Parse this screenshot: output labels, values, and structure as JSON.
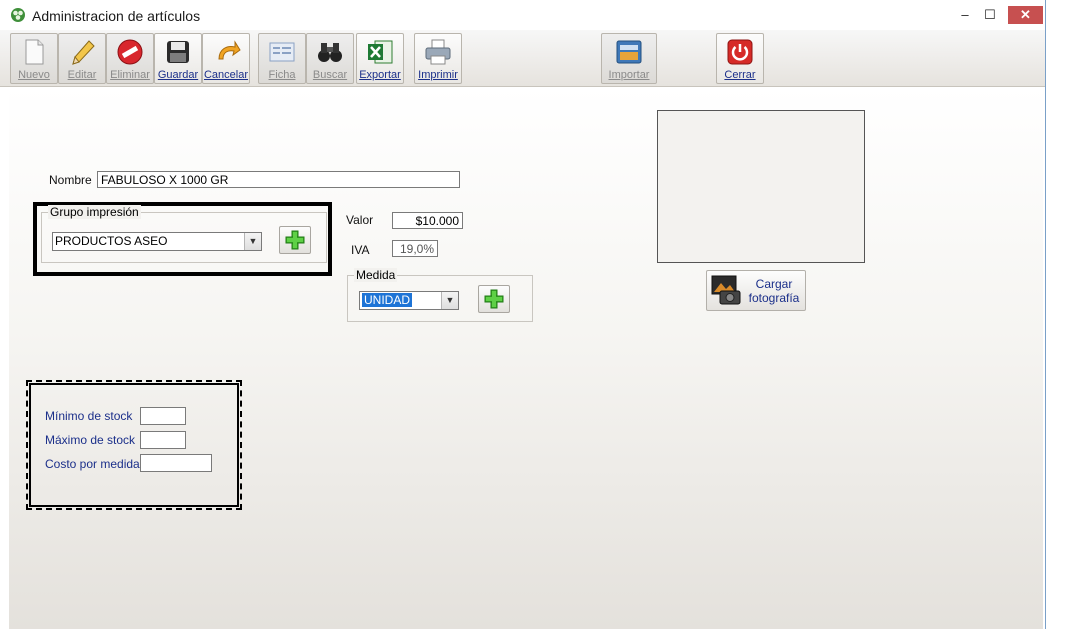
{
  "window": {
    "title": "Administracion de artículos",
    "controls": {
      "minimize": "–",
      "maximize": "☐",
      "close": "✕"
    }
  },
  "toolbar": {
    "nuevo": "Nuevo",
    "editar": "Editar",
    "eliminar": "Eliminar",
    "guardar": "Guardar",
    "cancelar": "Cancelar",
    "ficha": "Ficha",
    "buscar": "Buscar",
    "exportar": "Exportar",
    "imprimir": "Imprimir",
    "importar": "Importar",
    "cerrar": "Cerrar"
  },
  "form": {
    "nombre_label": "Nombre",
    "nombre_value": "FABULOSO X 1000 GR",
    "grupo_title": "Grupo impresión",
    "grupo_value": "PRODUCTOS ASEO",
    "valor_label": "Valor",
    "valor_value": "$10.000",
    "iva_label": "IVA",
    "iva_value": "19,0%",
    "medida_title": "Medida",
    "medida_value": "UNIDAD",
    "cargar_line1": "Cargar",
    "cargar_line2": "fotografía"
  },
  "stock": {
    "minimo_label": "Mínimo de stock",
    "maximo_label": "Máximo de stock",
    "costo_label": "Costo por medida",
    "minimo_value": "",
    "maximo_value": "",
    "costo_value": ""
  },
  "colors": {
    "close_button": "#c75050",
    "label_blue": "#1b2f8a",
    "selection": "#1e74d6"
  }
}
